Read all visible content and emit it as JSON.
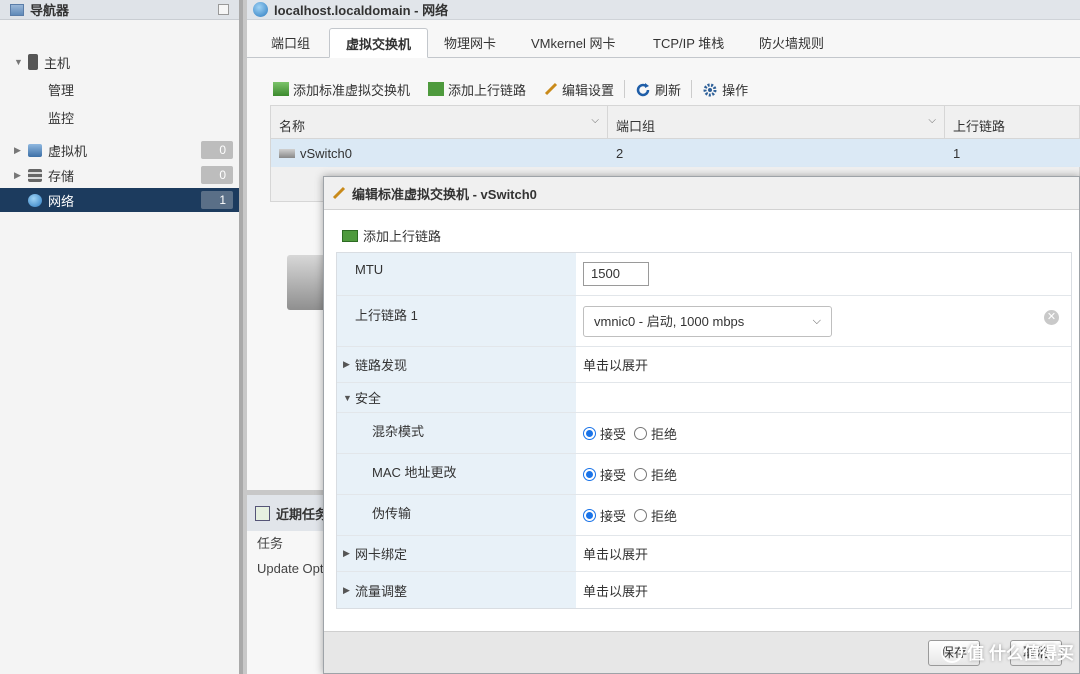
{
  "navigator": {
    "title": "导航器",
    "items": [
      {
        "label": "主机"
      },
      {
        "label": "管理"
      },
      {
        "label": "监控"
      },
      {
        "label": "虚拟机",
        "count": "0"
      },
      {
        "label": "存储",
        "count": "0"
      },
      {
        "label": "网络",
        "count": "1"
      }
    ]
  },
  "main": {
    "title": "localhost.localdomain - 网络",
    "tabs": [
      "端口组",
      "虚拟交换机",
      "物理网卡",
      "VMkernel 网卡",
      "TCP/IP 堆栈",
      "防火墙规则"
    ],
    "toolbar": {
      "add_switch": "添加标准虚拟交换机",
      "add_uplink": "添加上行链路",
      "edit": "编辑设置",
      "refresh": "刷新",
      "actions": "操作"
    },
    "grid": {
      "columns": [
        "名称",
        "端口组",
        "上行链路"
      ],
      "rows": [
        {
          "name": "vSwitch0",
          "portgroups": "2",
          "uplinks": "1"
        }
      ]
    }
  },
  "tasks": {
    "title": "近期任务",
    "column": "任务",
    "row": "Update Opt"
  },
  "dialog": {
    "title": "编辑标准虚拟交换机 - vSwitch0",
    "add_uplink": "添加上行链路",
    "mtu_label": "MTU",
    "mtu_value": "1500",
    "uplink_label": "上行链路 1",
    "uplink_value": "vmnic0 - 启动, 1000 mbps",
    "link_discovery_label": "链路发现",
    "expand_text": "单击以展开",
    "security_label": "安全",
    "promiscuous_label": "混杂模式",
    "mac_change_label": "MAC 地址更改",
    "forged_label": "伪传输",
    "accept": "接受",
    "reject": "拒绝",
    "nic_teaming_label": "网卡绑定",
    "traffic_shaping_label": "流量调整",
    "save": "保存",
    "cancel": "取消"
  },
  "watermark": "值 什么值得买"
}
